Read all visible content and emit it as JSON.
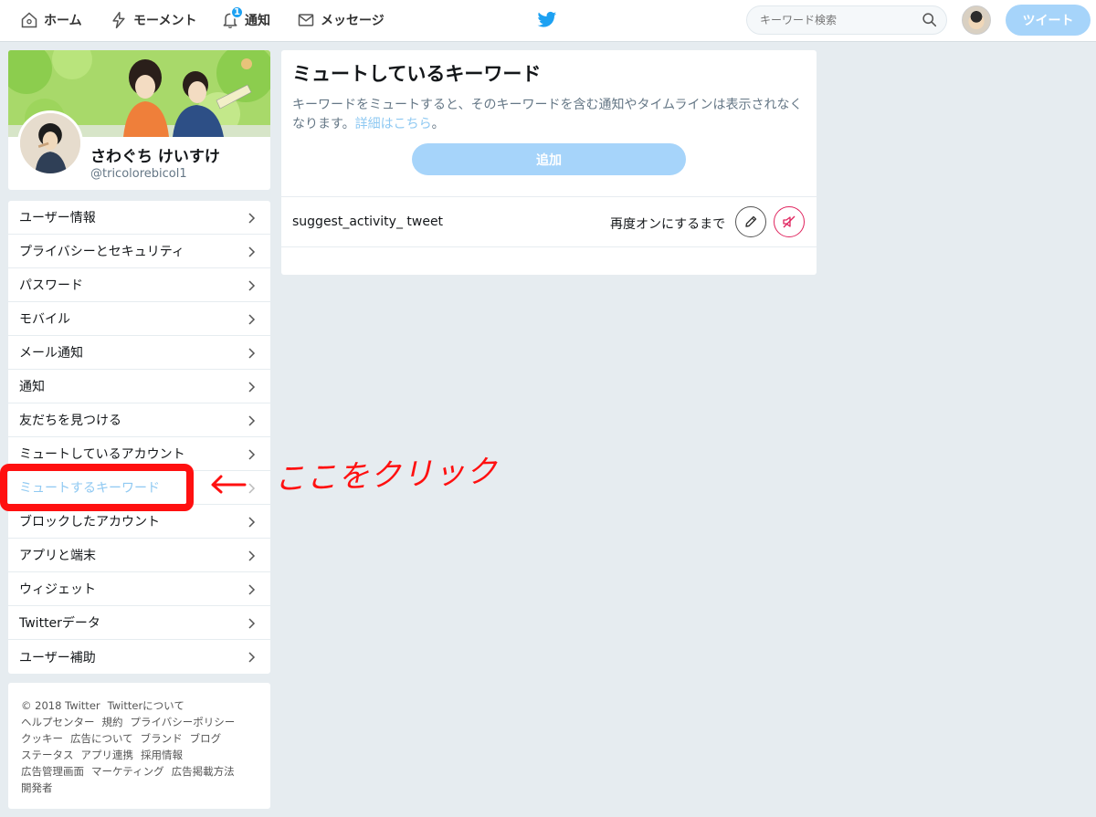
{
  "nav": {
    "home": "ホーム",
    "moments": "モーメント",
    "notifications": "通知",
    "notifications_badge": "1",
    "messages": "メッセージ",
    "search_placeholder": "キーワード検索",
    "tweet_button": "ツイート"
  },
  "profile": {
    "name": "さわぐち けいすけ",
    "handle": "@tricolorebicol1"
  },
  "settings": {
    "items": [
      {
        "label": "ユーザー情報"
      },
      {
        "label": "プライバシーとセキュリティ"
      },
      {
        "label": "パスワード"
      },
      {
        "label": "モバイル"
      },
      {
        "label": "メール通知"
      },
      {
        "label": "通知"
      },
      {
        "label": "友だちを見つける"
      },
      {
        "label": "ミュートしているアカウント"
      },
      {
        "label": "ミュートするキーワード"
      },
      {
        "label": "ブロックしたアカウント"
      },
      {
        "label": "アプリと端末"
      },
      {
        "label": "ウィジェット"
      },
      {
        "label": "Twitterデータ"
      },
      {
        "label": "ユーザー補助"
      }
    ],
    "active_index": 8
  },
  "footer": {
    "links": [
      [
        "© 2018 Twitter",
        "Twitterについて"
      ],
      [
        "ヘルプセンター",
        "規約",
        "プライバシーポリシー"
      ],
      [
        "クッキー",
        "広告について",
        "ブランド",
        "ブログ"
      ],
      [
        "ステータス",
        "アプリ連携",
        "採用情報"
      ],
      [
        "広告管理画面",
        "マーケティング",
        "広告掲載方法"
      ],
      [
        "開発者"
      ]
    ]
  },
  "main": {
    "title": "ミュートしているキーワード",
    "description": "キーワードをミュートすると、そのキーワードを含む通知やタイムラインは表示されなくなります。",
    "learn_more": "詳細はこちら",
    "description_end": "。",
    "add_button": "追加",
    "keyword": {
      "text": "suggest_activity_ tweet",
      "duration": "再度オンにするまで"
    }
  },
  "annotation": {
    "text": "ここをクリック",
    "color": "#ff1010"
  },
  "colors": {
    "accent": "#1da1f2",
    "accent_light": "#a6d4fa",
    "background": "#e6ecf0",
    "unmute_red": "#e0245e"
  }
}
